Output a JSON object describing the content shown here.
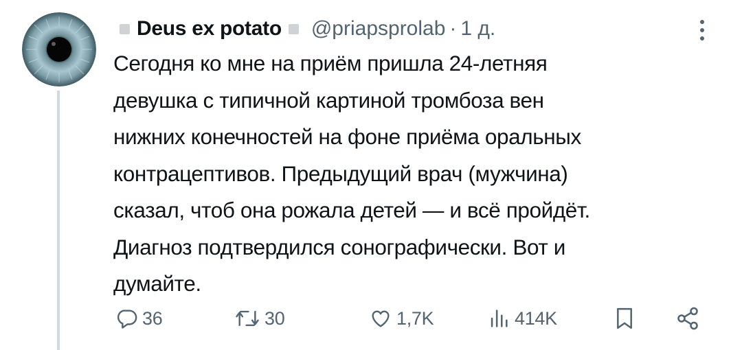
{
  "tweet": {
    "display_name": "Deus ex potato",
    "handle": "@priapsprolab",
    "separator": "·",
    "time": "1 д.",
    "text": "Сегодня ко мне на приём пришла 24-летняя\nдевушка с типичной картиной тромбоза вен\nнижних конечностей на фоне приёма оральных\nконтрацептивов. Предыдущий врач (мужчина)\nсказал, чтоб она рожала детей — и всё пройдёт.\nДиагноз подтвердился сонографически. Вот и\nдумайте."
  },
  "actions": {
    "replies": "36",
    "reposts": "30",
    "likes": "1,7K",
    "views": "414K"
  },
  "icons": {
    "avatar": "eye-avatar",
    "more": "more-vertical-icon",
    "reply": "reply-icon",
    "repost": "repost-icon",
    "like": "heart-icon",
    "views": "views-chart-icon",
    "bookmark": "bookmark-icon",
    "share": "share-icon"
  },
  "colors": {
    "text": "#0f1419",
    "secondary": "#536471",
    "thread_line": "#cfd9de"
  }
}
